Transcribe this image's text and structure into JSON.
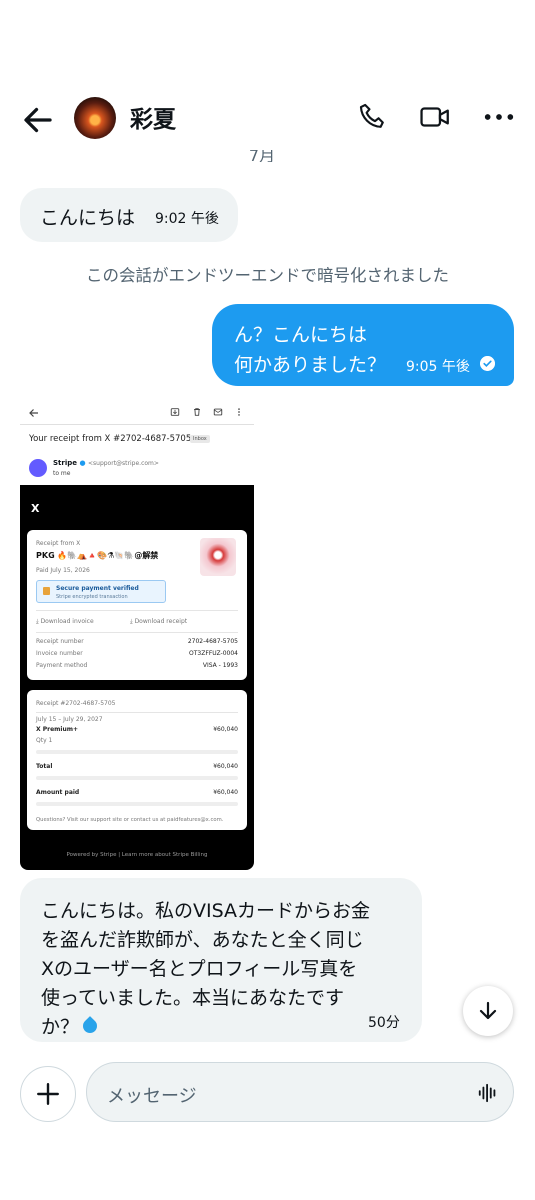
{
  "header": {
    "contact_name": "彩夏",
    "icons": [
      "back-arrow-icon",
      "phone-icon",
      "video-icon",
      "more-icon"
    ]
  },
  "date_separator": "7月",
  "messages": {
    "m1": {
      "text": "こんにちは",
      "time": "9:02 午後"
    },
    "system": "この会話がエンドツーエンドで暗号化されました",
    "m2": {
      "line1": "ん？こんにちは",
      "line2": "何かありました？",
      "time": "9:05 午後",
      "status_icon": "read-check-icon"
    },
    "m3": {
      "lines": [
        "こんにちは。私のVISAカードからお金",
        "を盗んだ詐欺師が、あなたと全く同じ",
        "Xのユーザー名とプロフィール写真を",
        "使っていました。本当にあなたです",
        "か？"
      ],
      "time": "50分"
    }
  },
  "receipt_image": {
    "subject": "Your receipt from X #2702-4687-5705",
    "inbox_label": "Inbox",
    "sender_name": "Stripe",
    "sender_email": "<support@stripe.com>",
    "to": "to me",
    "brand": "X",
    "receipt_from": "Receipt from X",
    "product_line": "PKG 🔥🐘⛺🔺🎨⚗🐚🐘@解禁",
    "paid_date": "Paid July 15, 2026",
    "secure_title": "Secure payment verified",
    "secure_sub": "Stripe encrypted transaction",
    "download_invoice": "Download invoice",
    "download_receipt": "Download receipt",
    "rows": [
      {
        "label": "Receipt number",
        "value": "2702-4687-5705"
      },
      {
        "label": "Invoice number",
        "value": "OT3ZFFUZ-0004"
      },
      {
        "label": "Payment method",
        "value": "VISA - 1993"
      }
    ],
    "receipt_no": "Receipt #2702-4687-5705",
    "period": "July 15 – July 29, 2027",
    "item": "X Premium+",
    "item_amount": "¥60,040",
    "qty": "Qty 1",
    "total_label": "Total",
    "total": "¥60,040",
    "paid_label": "Amount paid",
    "paid": "¥60,040",
    "questions": "Questions? Visit our support site or contact us at paidfeatures@x.com.",
    "footer": "Powered by Stripe | Learn more about Stripe Billing"
  },
  "composer": {
    "placeholder": "メッセージ"
  }
}
